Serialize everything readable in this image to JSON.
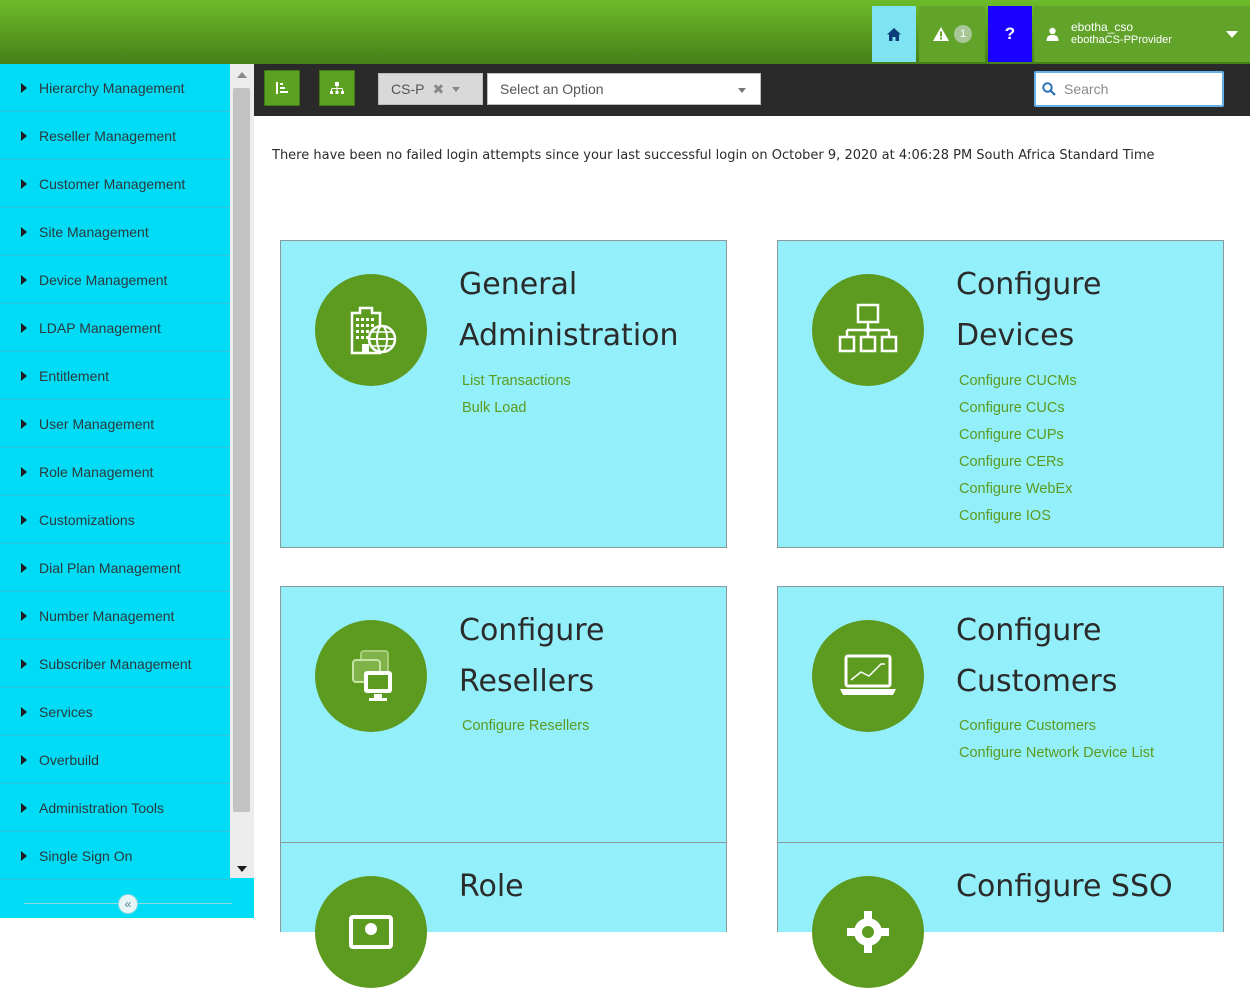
{
  "topbar": {
    "alert_count": "1",
    "help_symbol": "?",
    "user_name": "ebotha_cso",
    "user_provider": "ebothaCS-PProvider"
  },
  "sidebar": {
    "items": [
      {
        "label": "Hierarchy Management"
      },
      {
        "label": "Reseller Management"
      },
      {
        "label": "Customer Management"
      },
      {
        "label": "Site Management"
      },
      {
        "label": "Device Management"
      },
      {
        "label": "LDAP Management"
      },
      {
        "label": "Entitlement"
      },
      {
        "label": "User Management"
      },
      {
        "label": "Role Management"
      },
      {
        "label": "Customizations"
      },
      {
        "label": "Dial Plan Management"
      },
      {
        "label": "Number Management"
      },
      {
        "label": "Subscriber Management"
      },
      {
        "label": "Services"
      },
      {
        "label": "Overbuild"
      },
      {
        "label": "Administration Tools"
      },
      {
        "label": "Single Sign On"
      }
    ],
    "collapse_symbol": "«"
  },
  "toolbar": {
    "hierarchy_chip": "CS-P",
    "chip_clear": "✖",
    "select_placeholder": "Select an Option",
    "search_placeholder": "Search"
  },
  "notice": "There have been no failed login attempts since your last successful login on October 9, 2020 at 4:06:28 PM South Africa Standard Time",
  "cards": [
    {
      "title_line1": "General",
      "title_line2": "Administration",
      "links": [
        "List Transactions",
        "Bulk Load"
      ]
    },
    {
      "title_line1": "Configure",
      "title_line2": "Devices",
      "links": [
        "Configure CUCMs",
        "Configure CUCs",
        "Configure CUPs",
        "Configure CERs",
        "Configure WebEx",
        "Configure IOS"
      ]
    },
    {
      "title_line1": "Configure",
      "title_line2": "Resellers",
      "links": [
        "Configure Resellers"
      ]
    },
    {
      "title_line1": "Configure",
      "title_line2": "Customers",
      "links": [
        "Configure Customers",
        "Configure Network Device List"
      ]
    },
    {
      "title_line1": "Role"
    },
    {
      "title_line1": "Configure SSO"
    }
  ],
  "icons": {
    "home": "home-icon",
    "alert": "warning-icon",
    "user": "user-icon",
    "tree": "tree-view-icon",
    "hierarchy": "hierarchy-icon",
    "search": "search-icon"
  },
  "colors": {
    "accent_green": "#5d9a20",
    "sidebar_cyan": "#00dcf5",
    "card_cyan": "#93f0fb",
    "help_blue": "#1a00ff"
  }
}
